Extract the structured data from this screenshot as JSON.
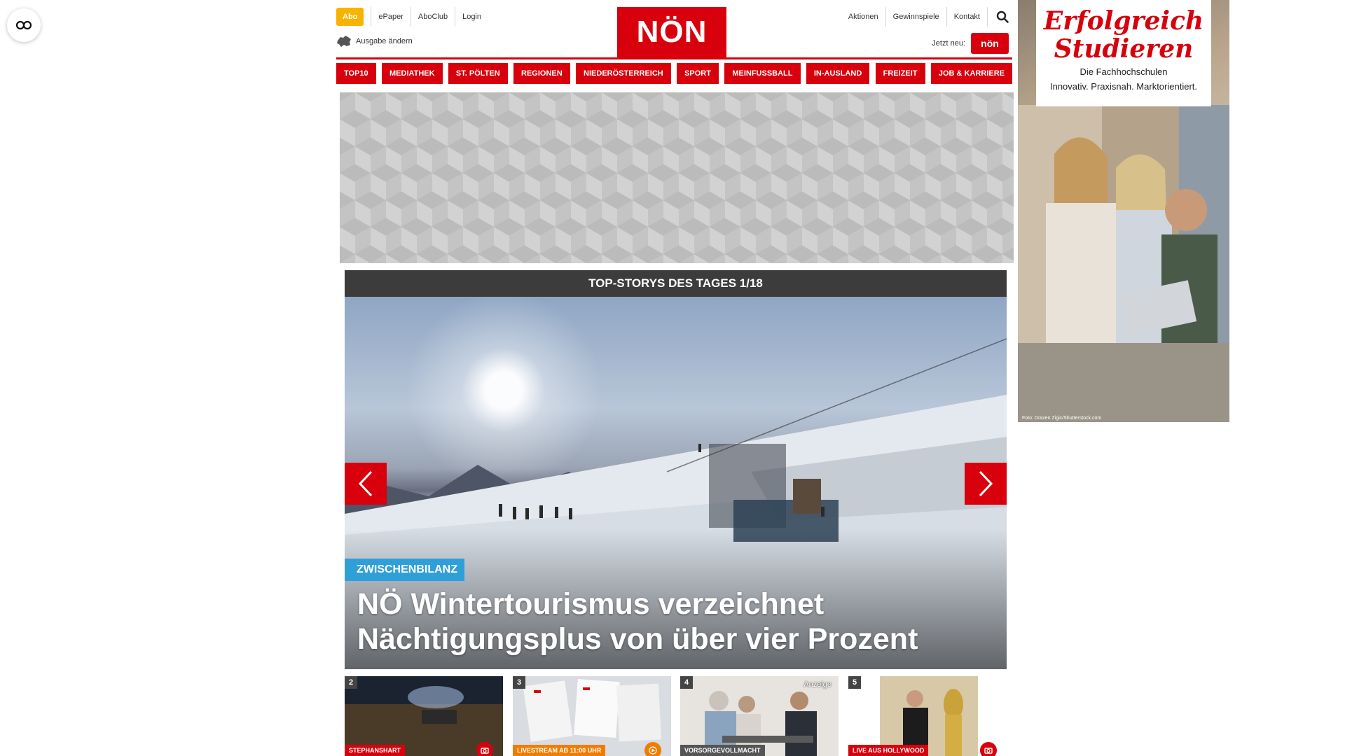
{
  "reader_button": {
    "icon": "glasses-icon"
  },
  "header": {
    "abo_label": "Abo",
    "links_left": [
      "ePaper",
      "AboClub",
      "Login"
    ],
    "edition_label": "Ausgabe ändern",
    "logo_text": "NÖN",
    "links_right": [
      "Aktionen",
      "Gewinnspiele",
      "Kontakt"
    ],
    "jetzt_label": "Jetzt neu:",
    "jetzt_badge_text": "nön"
  },
  "nav": {
    "items": [
      "TOP10",
      "MEDIATHEK",
      "ST. PÖLTEN",
      "REGIONEN",
      "NIEDERÖSTERREICH",
      "SPORT",
      "MEINFUSSBALL",
      "IN-AUSLAND",
      "FREIZEIT",
      "JOB & KARRIERE"
    ]
  },
  "top_stories": {
    "heading": "TOP-STORYS DES TAGES 1/18",
    "hero": {
      "tag": "ZWISCHENBILANZ",
      "title": "NÖ Wintertourismus verzeichnet Nächtigungsplus von über vier Prozent"
    },
    "teasers": [
      {
        "number": "2",
        "label": "STEPHANSHART",
        "label_color": "#d8000c",
        "icon": "camera-icon"
      },
      {
        "number": "3",
        "label": "LIVESTREAM AB 11:00 UHR",
        "label_color": "#f07d00",
        "icon": "play-icon"
      },
      {
        "number": "4",
        "label": "VORSORGEVOLLMACHT",
        "label_color": "#555555",
        "ad_label": "Anzeige"
      },
      {
        "number": "5",
        "label": "LIVE AUS HOLLYWOOD",
        "label_color": "#d8000c",
        "icon": "camera-icon"
      }
    ]
  },
  "right_ad": {
    "title": "Erfolgreich Studieren",
    "subtitle_1": "Die Fachhochschulen",
    "subtitle_2": "Innovativ. Praxisnah. Marktorientiert.",
    "credit": "Foto: Drazen Zigic/Shutterstock.com"
  },
  "colors": {
    "brand_red": "#d8000c",
    "abo_yellow": "#f6b400",
    "tag_blue": "#2f9fd8",
    "header_dark": "#3c3c3c"
  }
}
